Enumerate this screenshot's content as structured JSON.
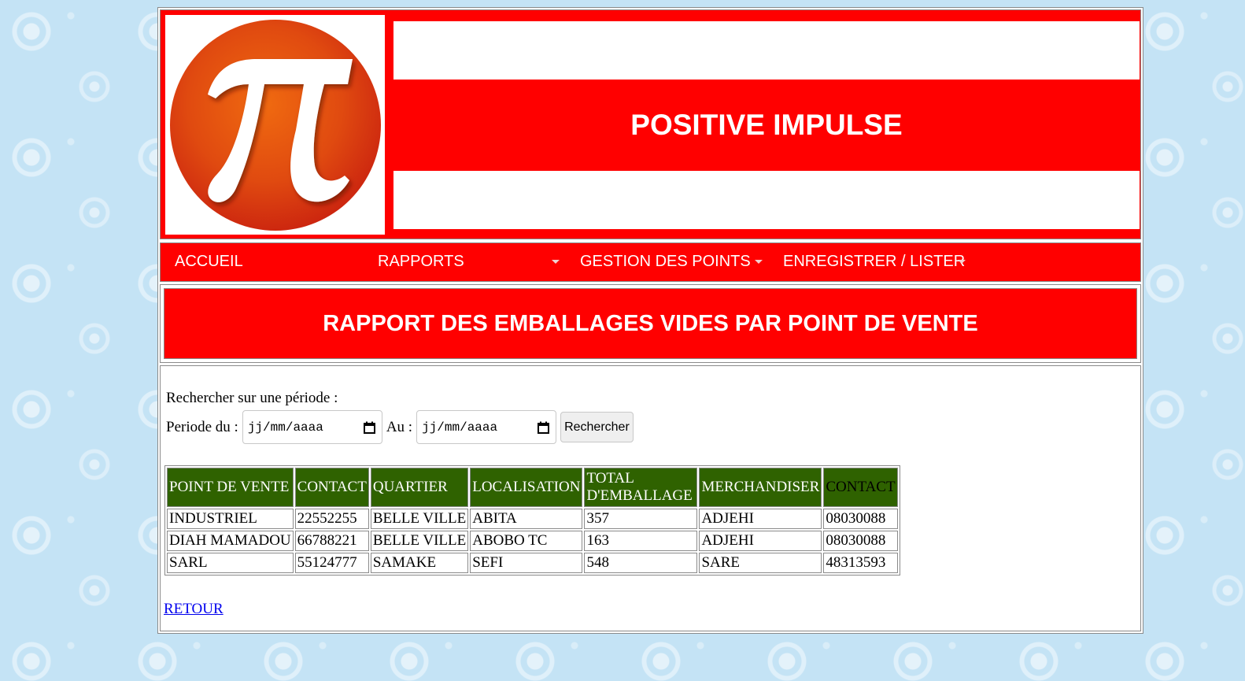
{
  "header": {
    "logo_symbol": "π",
    "title": "POSITIVE IMPULSE"
  },
  "nav": {
    "items": [
      {
        "label": "ACCUEIL",
        "has_dropdown": false
      },
      {
        "label": "RAPPORTS",
        "has_dropdown": true
      },
      {
        "label": "GESTION DES POINTS",
        "has_dropdown": true
      },
      {
        "label": "ENREGISTRER / LISTER",
        "has_dropdown": true
      }
    ]
  },
  "report": {
    "title": "RAPPORT DES EMBALLAGES VIDES PAR POINT DE VENTE"
  },
  "search": {
    "label": "Rechercher sur une période :",
    "from_label": "Periode du :",
    "from_placeholder": "jj/mm/aaaa",
    "to_label": "Au :",
    "to_placeholder": "jj/mm/aaaa",
    "button_label": "Rechercher"
  },
  "table": {
    "headers": [
      "POINT DE VENTE",
      "CONTACT",
      "QUARTIER",
      "LOCALISATION",
      "TOTAL D'EMBALLAGE",
      "MERCHANDISER",
      "CONTACT"
    ],
    "rows": [
      [
        "INDUSTRIEL",
        "22552255",
        "BELLE VILLE",
        "ABITA",
        "357",
        "ADJEHI",
        "08030088"
      ],
      [
        "DIAH MAMADOU",
        "66788221",
        "BELLE VILLE",
        "ABOBO TC",
        "163",
        "ADJEHI",
        "08030088"
      ],
      [
        "SARL",
        "55124777",
        "SAMAKE",
        "SEFI",
        "548",
        "SARE",
        "48313593"
      ]
    ]
  },
  "links": {
    "back": "RETOUR"
  },
  "colors": {
    "brand_red": "#ff0000",
    "table_header_green": "#2f6200",
    "page_background": "#c4e3f5"
  }
}
